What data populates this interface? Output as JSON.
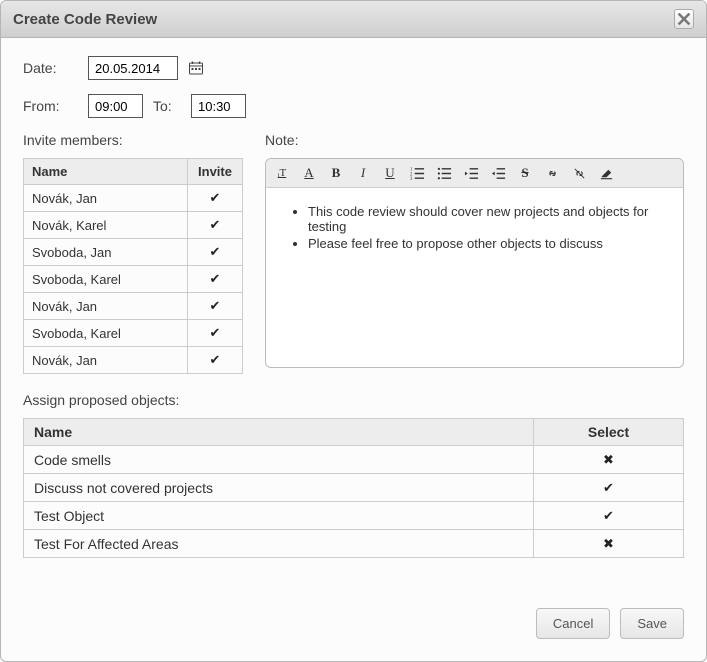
{
  "dialog": {
    "title": "Create Code Review"
  },
  "form": {
    "date_label": "Date:",
    "date_value": "20.05.2014",
    "from_label": "From:",
    "from_value": "09:00",
    "to_label": "To:",
    "to_value": "10:30"
  },
  "invite": {
    "label": "Invite members:",
    "col_name": "Name",
    "col_invite": "Invite",
    "members": [
      {
        "name": "Novák, Jan",
        "invited": true
      },
      {
        "name": "Novák, Karel",
        "invited": true
      },
      {
        "name": "Svoboda, Jan",
        "invited": true
      },
      {
        "name": "Svoboda, Karel",
        "invited": true
      },
      {
        "name": "Novák, Jan",
        "invited": true
      },
      {
        "name": "Svoboda, Karel",
        "invited": true
      },
      {
        "name": "Novák, Jan",
        "invited": true
      }
    ]
  },
  "note": {
    "label": "Note:",
    "bullets": [
      "This code review should cover new projects and objects for testing",
      "Please feel free to propose other objects to discuss"
    ]
  },
  "assign": {
    "label": "Assign proposed objects:",
    "col_name": "Name",
    "col_select": "Select",
    "objects": [
      {
        "name": "Code smells",
        "selected": false
      },
      {
        "name": "Discuss not covered projects",
        "selected": true
      },
      {
        "name": "Test Object",
        "selected": true
      },
      {
        "name": "Test For Affected Areas",
        "selected": false
      }
    ]
  },
  "buttons": {
    "cancel": "Cancel",
    "save": "Save"
  },
  "marks": {
    "check": "✔",
    "cross": "✖"
  }
}
